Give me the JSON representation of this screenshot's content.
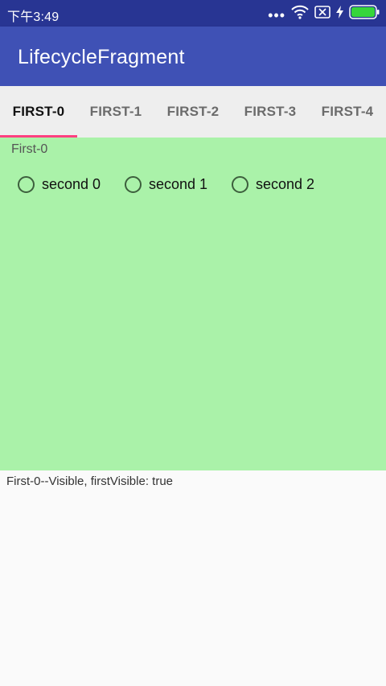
{
  "status_bar": {
    "time": "下午3:49",
    "icons": [
      "more-dots-icon",
      "wifi-icon",
      "sim-off-icon",
      "charging-icon",
      "battery-icon"
    ],
    "background": "#283593"
  },
  "app_bar": {
    "title": "LifecycleFragment",
    "background": "#3f51b5"
  },
  "tabs": [
    {
      "label": "FIRST-0",
      "active": true
    },
    {
      "label": "FIRST-1",
      "active": false
    },
    {
      "label": "FIRST-2",
      "active": false
    },
    {
      "label": "FIRST-3",
      "active": false
    },
    {
      "label": "FIRST-4",
      "active": false
    }
  ],
  "tab_indicator_color": "#ff4081",
  "fragment": {
    "label": "First-0",
    "background": "#aaf2a9",
    "radio_buttons": [
      {
        "label": "second 0",
        "checked": false
      },
      {
        "label": "second 1",
        "checked": false
      },
      {
        "label": "second 2",
        "checked": false
      }
    ]
  },
  "log": {
    "text": "First-0--Visible, firstVisible: true"
  }
}
